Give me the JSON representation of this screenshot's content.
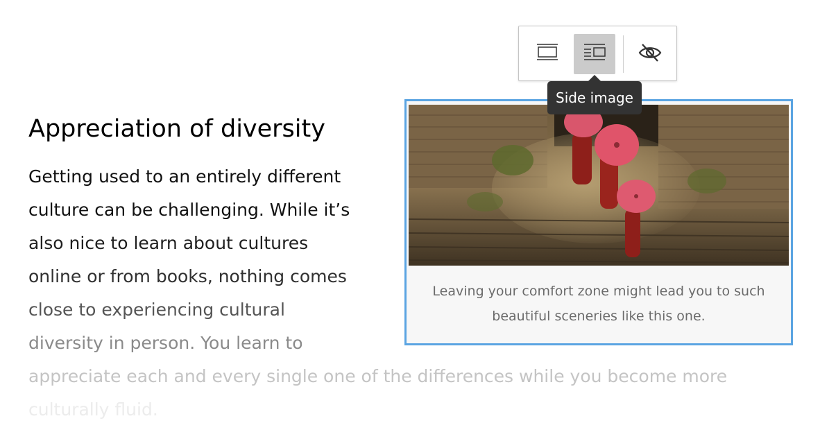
{
  "article": {
    "heading": "Appreciation of diversity",
    "body_lines": [
      "Getting used to an entirely different",
      "culture can be challenging. While it’s",
      "also nice to learn about cultures",
      "online or from books, nothing comes",
      "close to experiencing cultural",
      "diversity in person. You learn to",
      "appreciate each and every single one of the differences while you become more",
      "culturally fluid."
    ]
  },
  "figure": {
    "caption_lines": [
      "Leaving your comfort zone might lead you to such",
      "beautiful sceneries like this one."
    ]
  },
  "toolbar": {
    "buttons": [
      {
        "icon": "full-size-image-icon",
        "active": false
      },
      {
        "icon": "side-image-icon",
        "active": true
      },
      {
        "icon": "hide-eye-icon",
        "active": false
      }
    ],
    "tooltip": "Side image"
  },
  "colors": {
    "figure_border": "#5aa4e2",
    "tooltip_bg": "#333333",
    "active_button_bg": "#cbcbcb"
  }
}
